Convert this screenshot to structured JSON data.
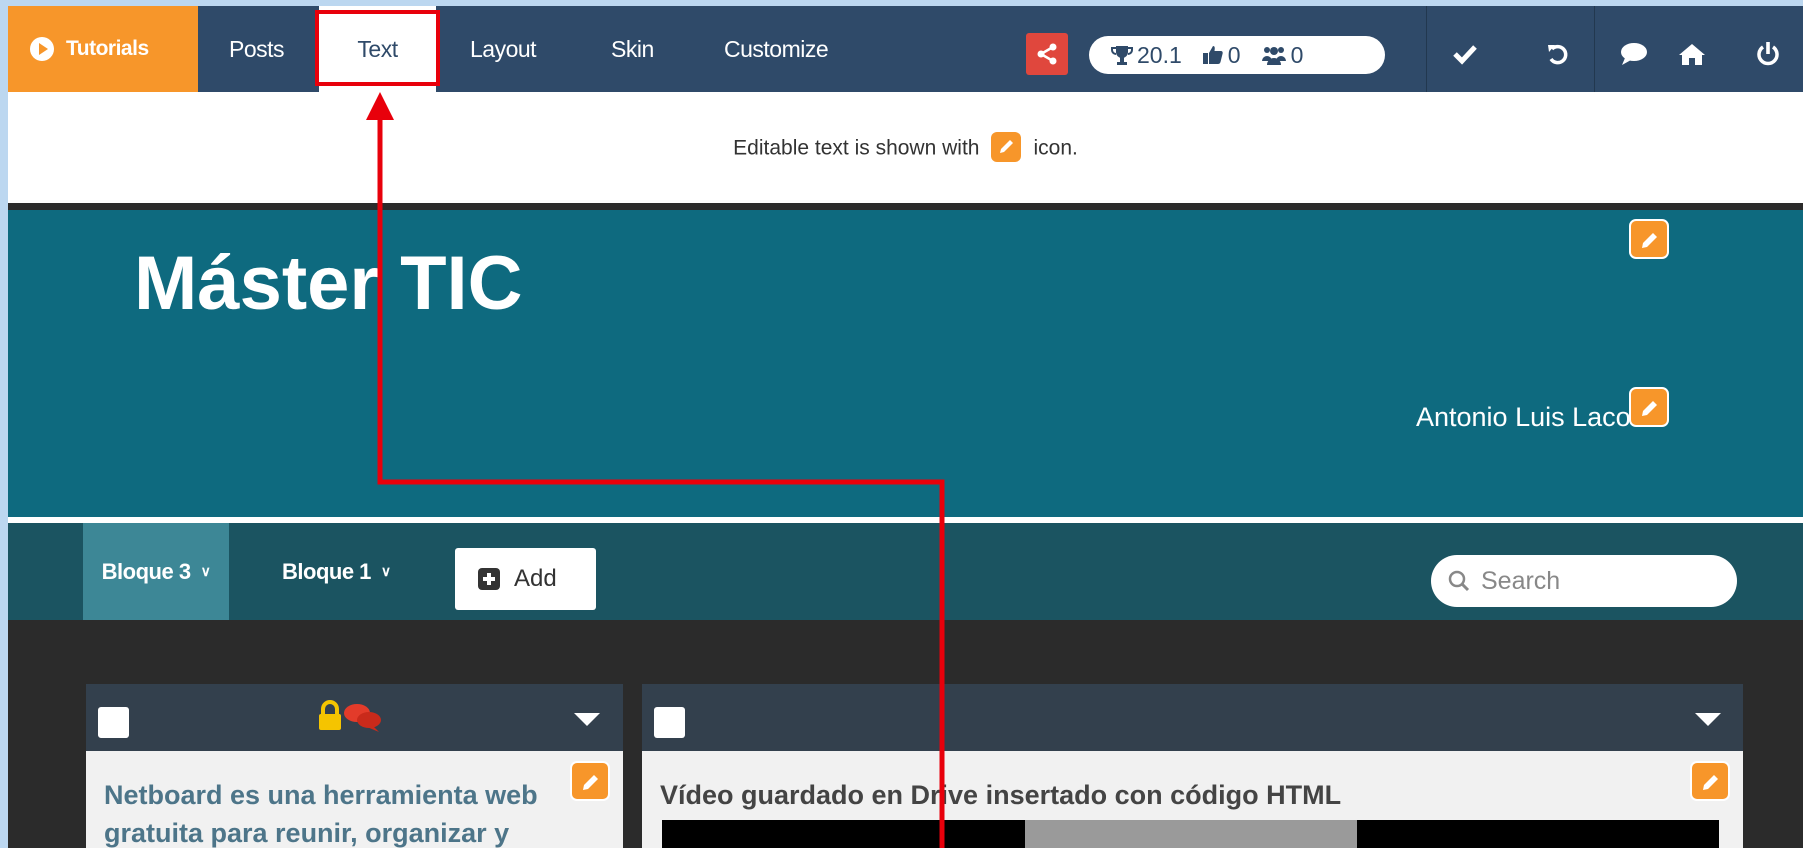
{
  "topbar": {
    "tutorials_label": "Tutorials",
    "nav": [
      "Posts",
      "Text",
      "Layout",
      "Skin",
      "Customize"
    ],
    "active_nav": "Text",
    "stats": {
      "score": "20.1",
      "likes": "0",
      "members": "0"
    }
  },
  "info": {
    "before": "Editable text is shown with",
    "after": "icon."
  },
  "banner": {
    "title": "Máster TIC",
    "author": "Antonio Luis Lacoba"
  },
  "tabs": [
    {
      "label": "Bloque 3",
      "active": true
    },
    {
      "label": "Bloque 1",
      "active": false
    }
  ],
  "add_label": "Add",
  "search": {
    "placeholder": "Search"
  },
  "cards": [
    {
      "title_line1": "Netboard es una herramienta web",
      "title_line2": "gratuita para reunir, organizar y"
    },
    {
      "title": "Vídeo guardado en Drive insertado con código HTML"
    }
  ],
  "colors": {
    "orange": "#f7962a",
    "navbar": "#2f4a69",
    "banner": "#0e6a7f",
    "highlight": "#e8000b"
  }
}
